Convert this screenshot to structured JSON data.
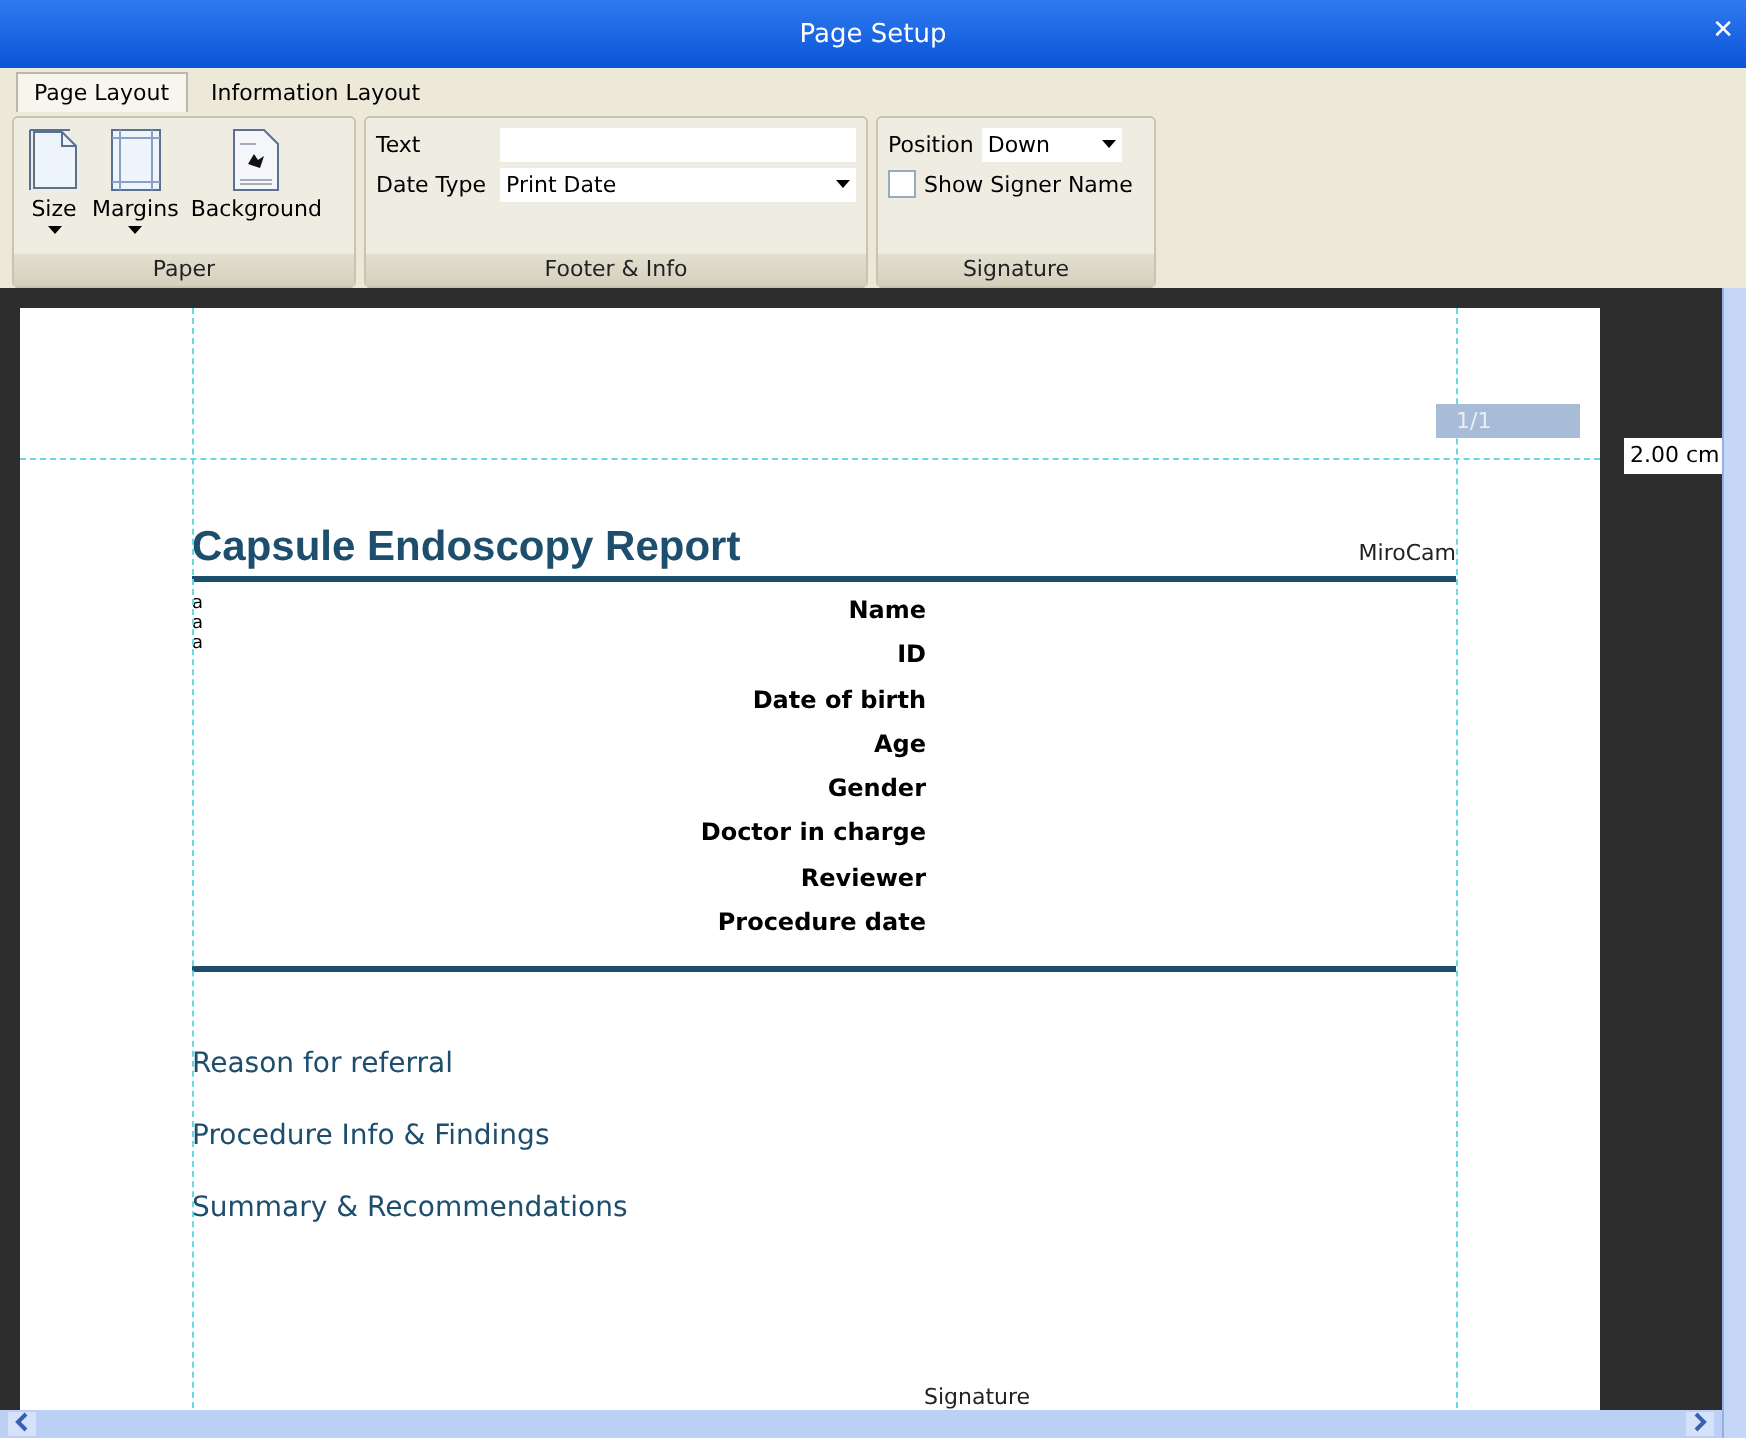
{
  "window": {
    "title": "Page Setup",
    "close": "✕"
  },
  "tabs": [
    {
      "label": "Page Layout",
      "selected": true
    },
    {
      "label": "Information Layout",
      "selected": false
    }
  ],
  "ribbon": {
    "paper": {
      "label": "Paper",
      "buttons": [
        {
          "label": "Size",
          "kind": "size",
          "dropdown": true
        },
        {
          "label": "Margins",
          "kind": "margins",
          "dropdown": true
        },
        {
          "label": "Background",
          "kind": "background",
          "dropdown": false
        }
      ]
    },
    "footer": {
      "label": "Footer & Info",
      "text_label": "Text",
      "date_label": "Date Type",
      "date_value": "Print Date"
    },
    "signature": {
      "label": "Signature",
      "position_label": "Position",
      "position_value": "Down",
      "show_signer": {
        "label": "Show Signer Name",
        "checked": false
      }
    }
  },
  "preview": {
    "page_indicator": "1/1",
    "margin_reading": "2.00 cm",
    "report": {
      "title": "Capsule Endoscopy Report",
      "brand": "MiroCam",
      "notes": [
        "a",
        "a",
        "a"
      ],
      "fields": [
        "Name",
        "ID",
        "Date of birth",
        "Age",
        "Gender",
        "Doctor in charge",
        "Reviewer",
        "Procedure date"
      ],
      "sections": [
        "Reason for referral",
        "Procedure Info & Findings",
        "Summary & Recommendations"
      ],
      "signature_label": "Signature"
    }
  }
}
